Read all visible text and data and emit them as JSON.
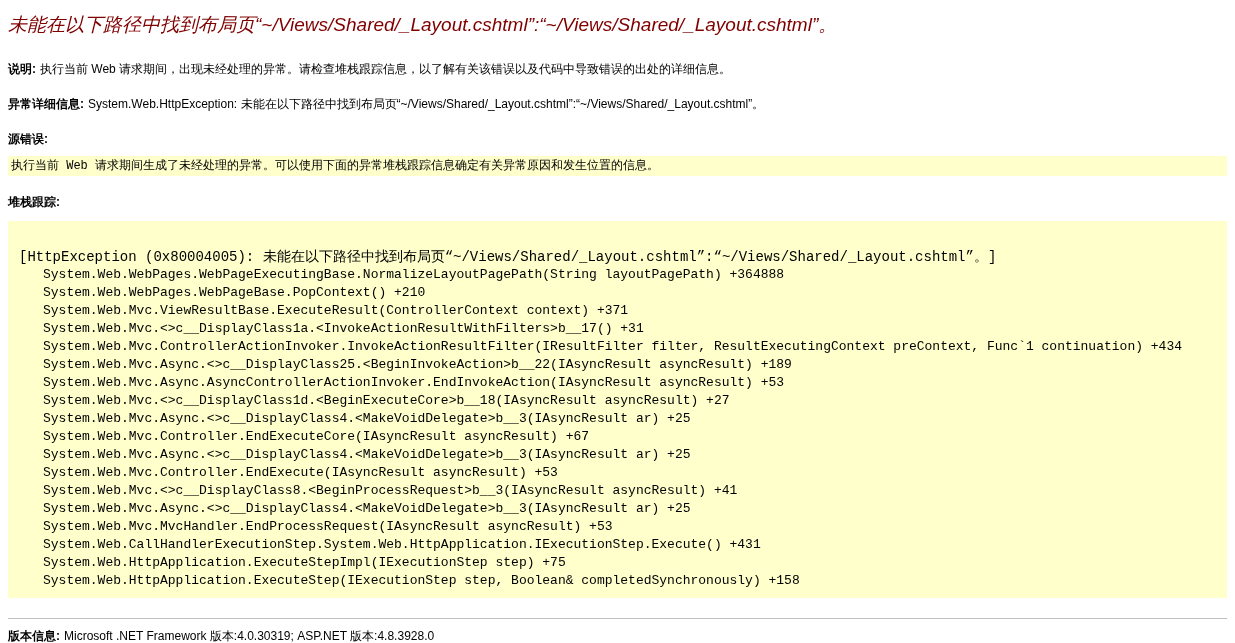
{
  "title": "未能在以下路径中找到布局页“~/Views/Shared/_Layout.cshtml”:“~/Views/Shared/_Layout.cshtml”。",
  "description": {
    "label": "说明:",
    "text": "执行当前 Web 请求期间，出现未经处理的异常。请检查堆栈跟踪信息，以了解有关该错误以及代码中导致错误的出处的详细信息。"
  },
  "exception_details": {
    "label": "异常详细信息:",
    "text": "System.Web.HttpException: 未能在以下路径中找到布局页“~/Views/Shared/_Layout.cshtml”:“~/Views/Shared/_Layout.cshtml”。"
  },
  "source_error": {
    "label": "源错误:",
    "message": "执行当前 Web 请求期间生成了未经处理的异常。可以使用下面的异常堆栈跟踪信息确定有关异常原因和发生位置的信息。"
  },
  "stack_trace": {
    "label": "堆栈跟踪:",
    "header": "[HttpException (0x80004005): 未能在以下路径中找到布局页“~/Views/Shared/_Layout.cshtml”:“~/Views/Shared/_Layout.cshtml”。]",
    "frames": [
      "System.Web.WebPages.WebPageExecutingBase.NormalizeLayoutPagePath(String layoutPagePath) +364888",
      "System.Web.WebPages.WebPageBase.PopContext() +210",
      "System.Web.Mvc.ViewResultBase.ExecuteResult(ControllerContext context) +371",
      "System.Web.Mvc.<>c__DisplayClass1a.<InvokeActionResultWithFilters>b__17() +31",
      "System.Web.Mvc.ControllerActionInvoker.InvokeActionResultFilter(IResultFilter filter, ResultExecutingContext preContext, Func`1 continuation) +434",
      "System.Web.Mvc.Async.<>c__DisplayClass25.<BeginInvokeAction>b__22(IAsyncResult asyncResult) +189",
      "System.Web.Mvc.Async.AsyncControllerActionInvoker.EndInvokeAction(IAsyncResult asyncResult) +53",
      "System.Web.Mvc.<>c__DisplayClass1d.<BeginExecuteCore>b__18(IAsyncResult asyncResult) +27",
      "System.Web.Mvc.Async.<>c__DisplayClass4.<MakeVoidDelegate>b__3(IAsyncResult ar) +25",
      "System.Web.Mvc.Controller.EndExecuteCore(IAsyncResult asyncResult) +67",
      "System.Web.Mvc.Async.<>c__DisplayClass4.<MakeVoidDelegate>b__3(IAsyncResult ar) +25",
      "System.Web.Mvc.Controller.EndExecute(IAsyncResult asyncResult) +53",
      "System.Web.Mvc.<>c__DisplayClass8.<BeginProcessRequest>b__3(IAsyncResult asyncResult) +41",
      "System.Web.Mvc.Async.<>c__DisplayClass4.<MakeVoidDelegate>b__3(IAsyncResult ar) +25",
      "System.Web.Mvc.MvcHandler.EndProcessRequest(IAsyncResult asyncResult) +53",
      "System.Web.CallHandlerExecutionStep.System.Web.HttpApplication.IExecutionStep.Execute() +431",
      "System.Web.HttpApplication.ExecuteStepImpl(IExecutionStep step) +75",
      "System.Web.HttpApplication.ExecuteStep(IExecutionStep step, Boolean& completedSynchronously) +158"
    ]
  },
  "version_info": {
    "label": "版本信息:",
    "text": "Microsoft .NET Framework 版本:4.0.30319; ASP.NET 版本:4.8.3928.0"
  }
}
